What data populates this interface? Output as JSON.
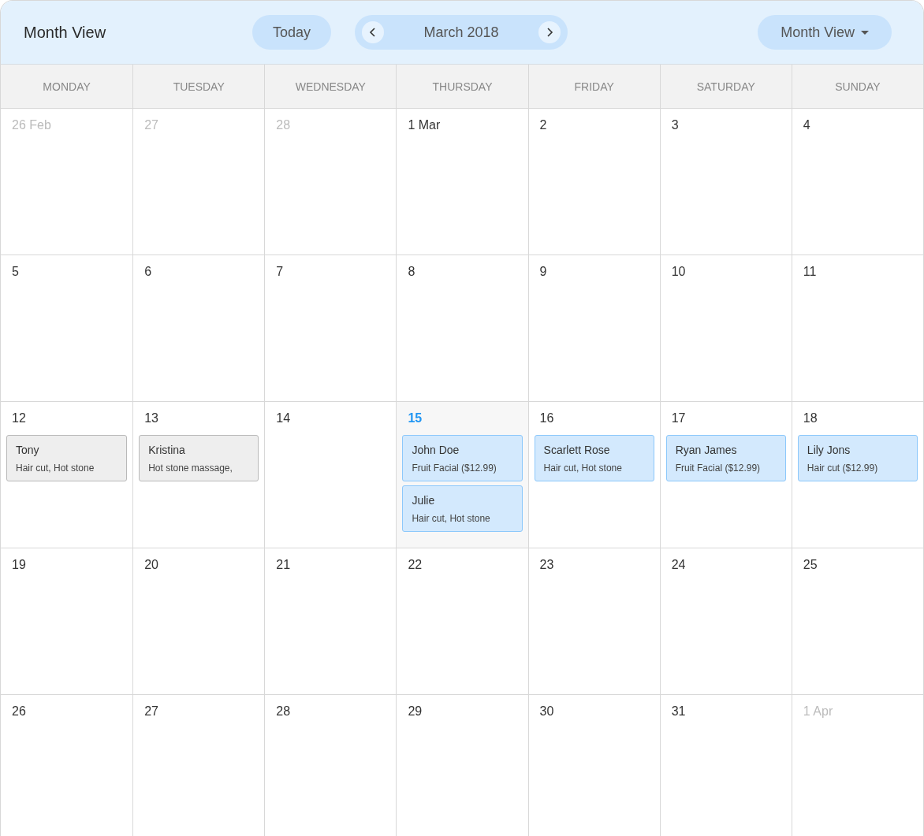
{
  "header": {
    "title": "Month View",
    "today_button": "Today",
    "month": "March 2018",
    "view_select": "Month View"
  },
  "weekdays": [
    "MONDAY",
    "TUESDAY",
    "WEDNESDAY",
    "THURSDAY",
    "FRIDAY",
    "SATURDAY",
    "SUNDAY"
  ],
  "weeks": [
    {
      "days": [
        {
          "label": "26 Feb",
          "outside": true,
          "today": false
        },
        {
          "label": "27",
          "outside": true,
          "today": false
        },
        {
          "label": "28",
          "outside": true,
          "today": false
        },
        {
          "label": "1 Mar",
          "outside": false,
          "today": false
        },
        {
          "label": "2",
          "outside": false,
          "today": false
        },
        {
          "label": "3",
          "outside": false,
          "today": false
        },
        {
          "label": "4",
          "outside": false,
          "today": false
        }
      ]
    },
    {
      "days": [
        {
          "label": "5",
          "outside": false,
          "today": false
        },
        {
          "label": "6",
          "outside": false,
          "today": false
        },
        {
          "label": "7",
          "outside": false,
          "today": false
        },
        {
          "label": "8",
          "outside": false,
          "today": false
        },
        {
          "label": "9",
          "outside": false,
          "today": false
        },
        {
          "label": "10",
          "outside": false,
          "today": false
        },
        {
          "label": "11",
          "outside": false,
          "today": false
        }
      ]
    },
    {
      "days": [
        {
          "label": "12",
          "outside": false,
          "today": false,
          "events": [
            {
              "kind": "past",
              "name": "Tony",
              "service": "Hair cut, Hot stone"
            }
          ]
        },
        {
          "label": "13",
          "outside": false,
          "today": false,
          "events": [
            {
              "kind": "past",
              "name": "Kristina",
              "service": "Hot stone massage,"
            }
          ]
        },
        {
          "label": "14",
          "outside": false,
          "today": false
        },
        {
          "label": "15",
          "outside": false,
          "today": true,
          "events": [
            {
              "kind": "upcoming",
              "name": "John Doe",
              "service": "Fruit Facial ($12.99)"
            },
            {
              "kind": "upcoming",
              "name": "Julie",
              "service": "Hair cut, Hot stone"
            }
          ]
        },
        {
          "label": "16",
          "outside": false,
          "today": false,
          "events": [
            {
              "kind": "upcoming",
              "name": "Scarlett Rose",
              "service": "Hair cut, Hot stone"
            }
          ]
        },
        {
          "label": "17",
          "outside": false,
          "today": false,
          "events": [
            {
              "kind": "upcoming",
              "name": "Ryan James",
              "service": "Fruit Facial ($12.99)"
            }
          ]
        },
        {
          "label": "18",
          "outside": false,
          "today": false,
          "events": [
            {
              "kind": "upcoming",
              "name": "Lily Jons",
              "service": "Hair cut ($12.99)"
            }
          ]
        }
      ]
    },
    {
      "days": [
        {
          "label": "19",
          "outside": false,
          "today": false
        },
        {
          "label": "20",
          "outside": false,
          "today": false
        },
        {
          "label": "21",
          "outside": false,
          "today": false
        },
        {
          "label": "22",
          "outside": false,
          "today": false
        },
        {
          "label": "23",
          "outside": false,
          "today": false
        },
        {
          "label": "24",
          "outside": false,
          "today": false
        },
        {
          "label": "25",
          "outside": false,
          "today": false
        }
      ]
    },
    {
      "days": [
        {
          "label": "26",
          "outside": false,
          "today": false
        },
        {
          "label": "27",
          "outside": false,
          "today": false
        },
        {
          "label": "28",
          "outside": false,
          "today": false
        },
        {
          "label": "29",
          "outside": false,
          "today": false
        },
        {
          "label": "30",
          "outside": false,
          "today": false
        },
        {
          "label": "31",
          "outside": false,
          "today": false
        },
        {
          "label": "1 Apr",
          "outside": true,
          "today": false
        }
      ]
    }
  ]
}
